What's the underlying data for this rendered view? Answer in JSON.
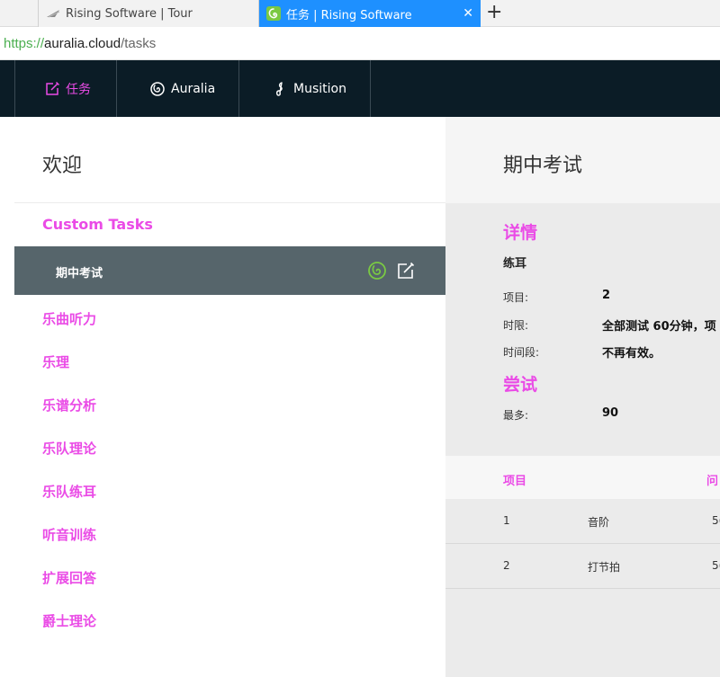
{
  "browser": {
    "tabs": [
      {
        "title": "Rising Software | Tour",
        "active": false,
        "icon": "rising-software-logo-icon"
      },
      {
        "title": "任务 | Rising Software",
        "active": true,
        "icon": "auralia-icon"
      }
    ],
    "close_glyph": "✕",
    "new_tab_glyph": "+",
    "url": {
      "scheme": "https://",
      "host": "auralia.cloud",
      "path": "/tasks"
    }
  },
  "nav": {
    "items": [
      {
        "label": "任务",
        "icon": "edit-icon",
        "active": true
      },
      {
        "label": "Auralia",
        "icon": "auralia-icon",
        "active": false
      },
      {
        "label": "Musition",
        "icon": "musition-icon",
        "active": false
      }
    ]
  },
  "left": {
    "welcome": "欢迎",
    "custom_tasks_title": "Custom Tasks",
    "selected_task": "期中考试",
    "categories": [
      "乐曲听力",
      "乐理",
      "乐谱分析",
      "乐队理论",
      "乐队练耳",
      "听音训练",
      "扩展回答",
      "爵士理论"
    ]
  },
  "right": {
    "title": "期中考试",
    "details_title": "详情",
    "details_sub": "练耳",
    "details": [
      {
        "label": "项目:",
        "value": "2"
      },
      {
        "label": "时限:",
        "value": "全部测试 60分钟，项"
      },
      {
        "label": "时间段:",
        "value": "不再有效。"
      }
    ],
    "attempts_title": "尝试",
    "attempts": [
      {
        "label": "最多:",
        "value": "90"
      }
    ],
    "table": {
      "headers": [
        "项目",
        "问"
      ],
      "rows": [
        {
          "num": "1",
          "name": "音阶",
          "extra": "5("
        },
        {
          "num": "2",
          "name": "打节拍",
          "extra": "5("
        }
      ]
    }
  },
  "colors": {
    "accent": "#ea4be6",
    "nav_bg": "#0b1c26",
    "selected_row": "#56656b",
    "tab_active": "#1e90ff",
    "auralia_green": "#7ac943"
  }
}
